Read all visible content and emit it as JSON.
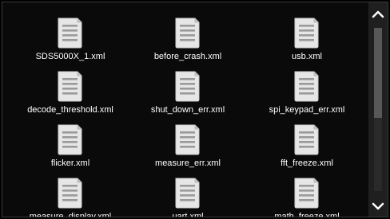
{
  "file_browser": {
    "files": [
      {
        "name": "SDS5000X_1.xml"
      },
      {
        "name": "before_crash.xml"
      },
      {
        "name": "usb.xml"
      },
      {
        "name": "decode_threshold.xml"
      },
      {
        "name": "shut_down_err.xml"
      },
      {
        "name": "spi_keypad_err.xml"
      },
      {
        "name": "flicker.xml"
      },
      {
        "name": "measure_err.xml"
      },
      {
        "name": "fft_freeze.xml"
      },
      {
        "name": "measure_display.xml"
      },
      {
        "name": "uart.xml"
      },
      {
        "name": "math_freeze.xml"
      }
    ]
  },
  "scrollbar": {
    "up_icon": "chevron-up-icon",
    "down_icon": "chevron-down-icon",
    "thumb_fraction": 0.55,
    "scroll_position": 0.0
  },
  "colors": {
    "background": "#0a0a0a",
    "text": "#ffffff",
    "icon_fill": "#e6e6e6",
    "icon_lines": "#9a9a9a"
  }
}
